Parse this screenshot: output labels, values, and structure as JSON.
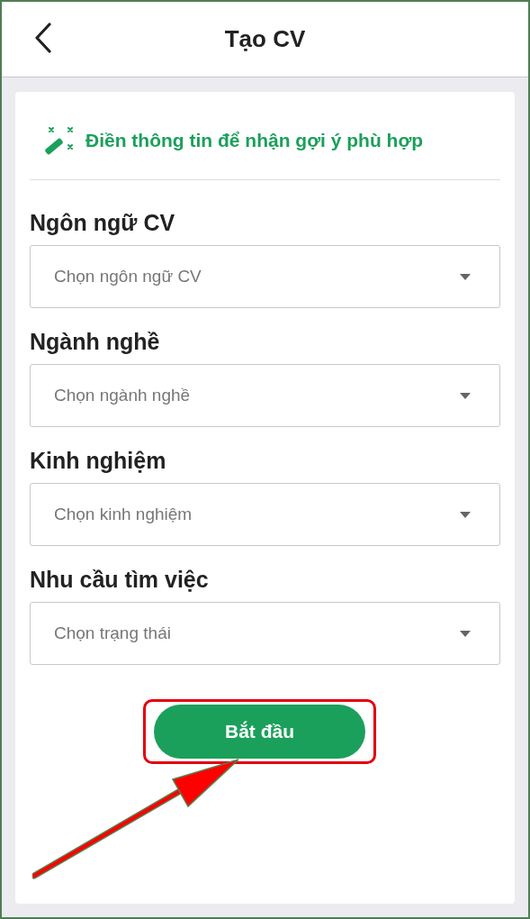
{
  "header": {
    "title": "Tạo CV"
  },
  "card": {
    "heading": "Điền thông tin để nhận gợi ý phù hợp",
    "fields": [
      {
        "label": "Ngôn ngữ CV",
        "placeholder": "Chọn ngôn ngữ CV"
      },
      {
        "label": "Ngành nghề",
        "placeholder": "Chọn ngành nghề"
      },
      {
        "label": "Kinh nghiệm",
        "placeholder": "Chọn kinh nghiệm"
      },
      {
        "label": "Nhu cầu tìm việc",
        "placeholder": "Chọn trạng thái"
      }
    ],
    "button": "Bắt đầu"
  }
}
